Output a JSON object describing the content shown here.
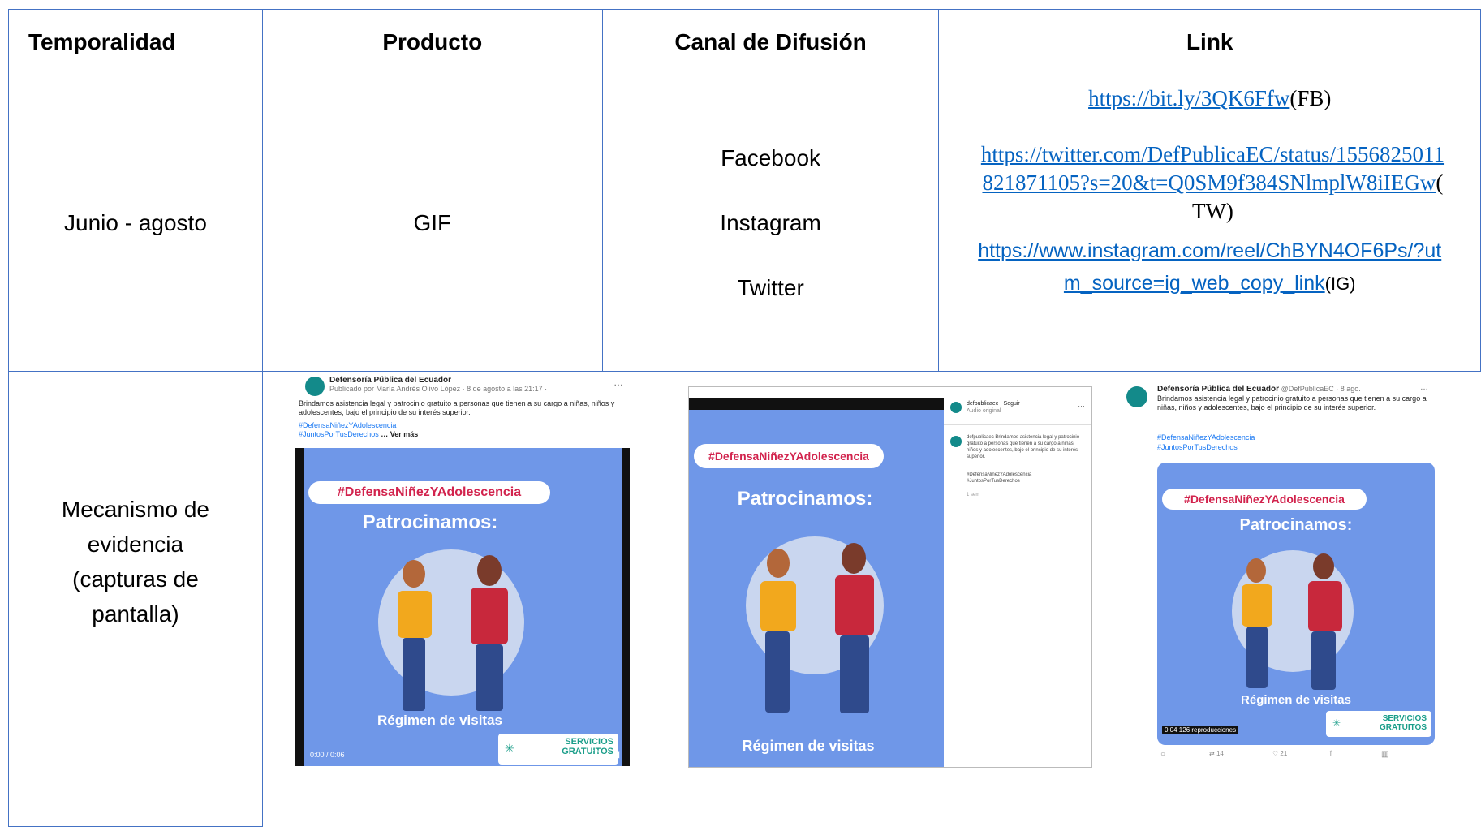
{
  "table": {
    "headers": [
      "Temporalidad",
      "Producto",
      "Canal de Difusión",
      "Link"
    ],
    "row1": {
      "temporalidad": "Junio - agosto",
      "producto": "GIF",
      "canales": [
        "Facebook",
        "Instagram",
        "Twitter"
      ],
      "links": [
        {
          "url_lines": [
            "https://bit.ly/3QK6Ffw"
          ],
          "tag": "(FB)"
        },
        {
          "url_lines": [
            "https://twitter.com/DefPublicaEC/status/1556825011",
            "821871105?s=20&t=Q0SM9f384SNlmplW8iIEGw"
          ],
          "tag_lines": [
            "(",
            "TW)"
          ]
        },
        {
          "url_lines": [
            "https://www.instagram.com/reel/ChBYN4OF6Ps/?ut",
            "m_source=ig_web_copy_link"
          ],
          "tag": "(IG)"
        }
      ]
    },
    "row2": {
      "label_lines": [
        "Mecanismo de",
        "evidencia",
        "(capturas de",
        "pantalla)"
      ]
    }
  },
  "screenshots": {
    "facebook": {
      "page_name": "Defensoría Pública del Ecuador",
      "published_by": "Publicado por María Andrés Olivo López · 8 de agosto a las 21:17 · ",
      "body": "Brindamos asistencia legal y patrocinio gratuito a personas que tienen a su cargo a niñas, niños y adolescentes, bajo el principio de su interés superior.",
      "hashtags": [
        "#DefensaNiñezYAdolescencia",
        "#JuntosPorTusDerechos"
      ],
      "see_more": "… Ver más",
      "more_icon": "…",
      "time": "0:00 / 0:06"
    },
    "instagram": {
      "account": "defpublicaec · Seguir",
      "audio": "Audio original",
      "caption": "defpublicaec Brindamos asistencia legal y patrocinio gratuito a personas que tienen a su cargo a niñas, niños y adolescentes, bajo el principio de su interés superior.",
      "hashtags": [
        "#DefensaNiñezYAdolescencia",
        "#JuntosPorTusDerechos"
      ],
      "ago": "1 sem"
    },
    "twitter": {
      "name": "Defensoría Pública del Ecuador",
      "handle": "@DefPublicaEC · 8 ago.",
      "body": "Brindamos asistencia legal y patrocinio gratuito a personas que tienen a su cargo a niñas, niños y adolescentes, bajo el principio de su interés superior.",
      "hashtags": [
        "#DefensaNiñezYAdolescencia",
        "#JuntosPorTusDerechos"
      ],
      "views": "0:04  126 reproducciones",
      "actions": [
        "14",
        "21"
      ]
    },
    "gif": {
      "hashtag": "#DefensaNiñezYAdolescencia",
      "title": "Patrocinamos:",
      "subtitle": "Régimen de visitas",
      "badge": "SERVICIOS\nGRATUITOS",
      "badge_line1": "SERVICIOS",
      "badge_line2": "GRATUITOS"
    }
  }
}
